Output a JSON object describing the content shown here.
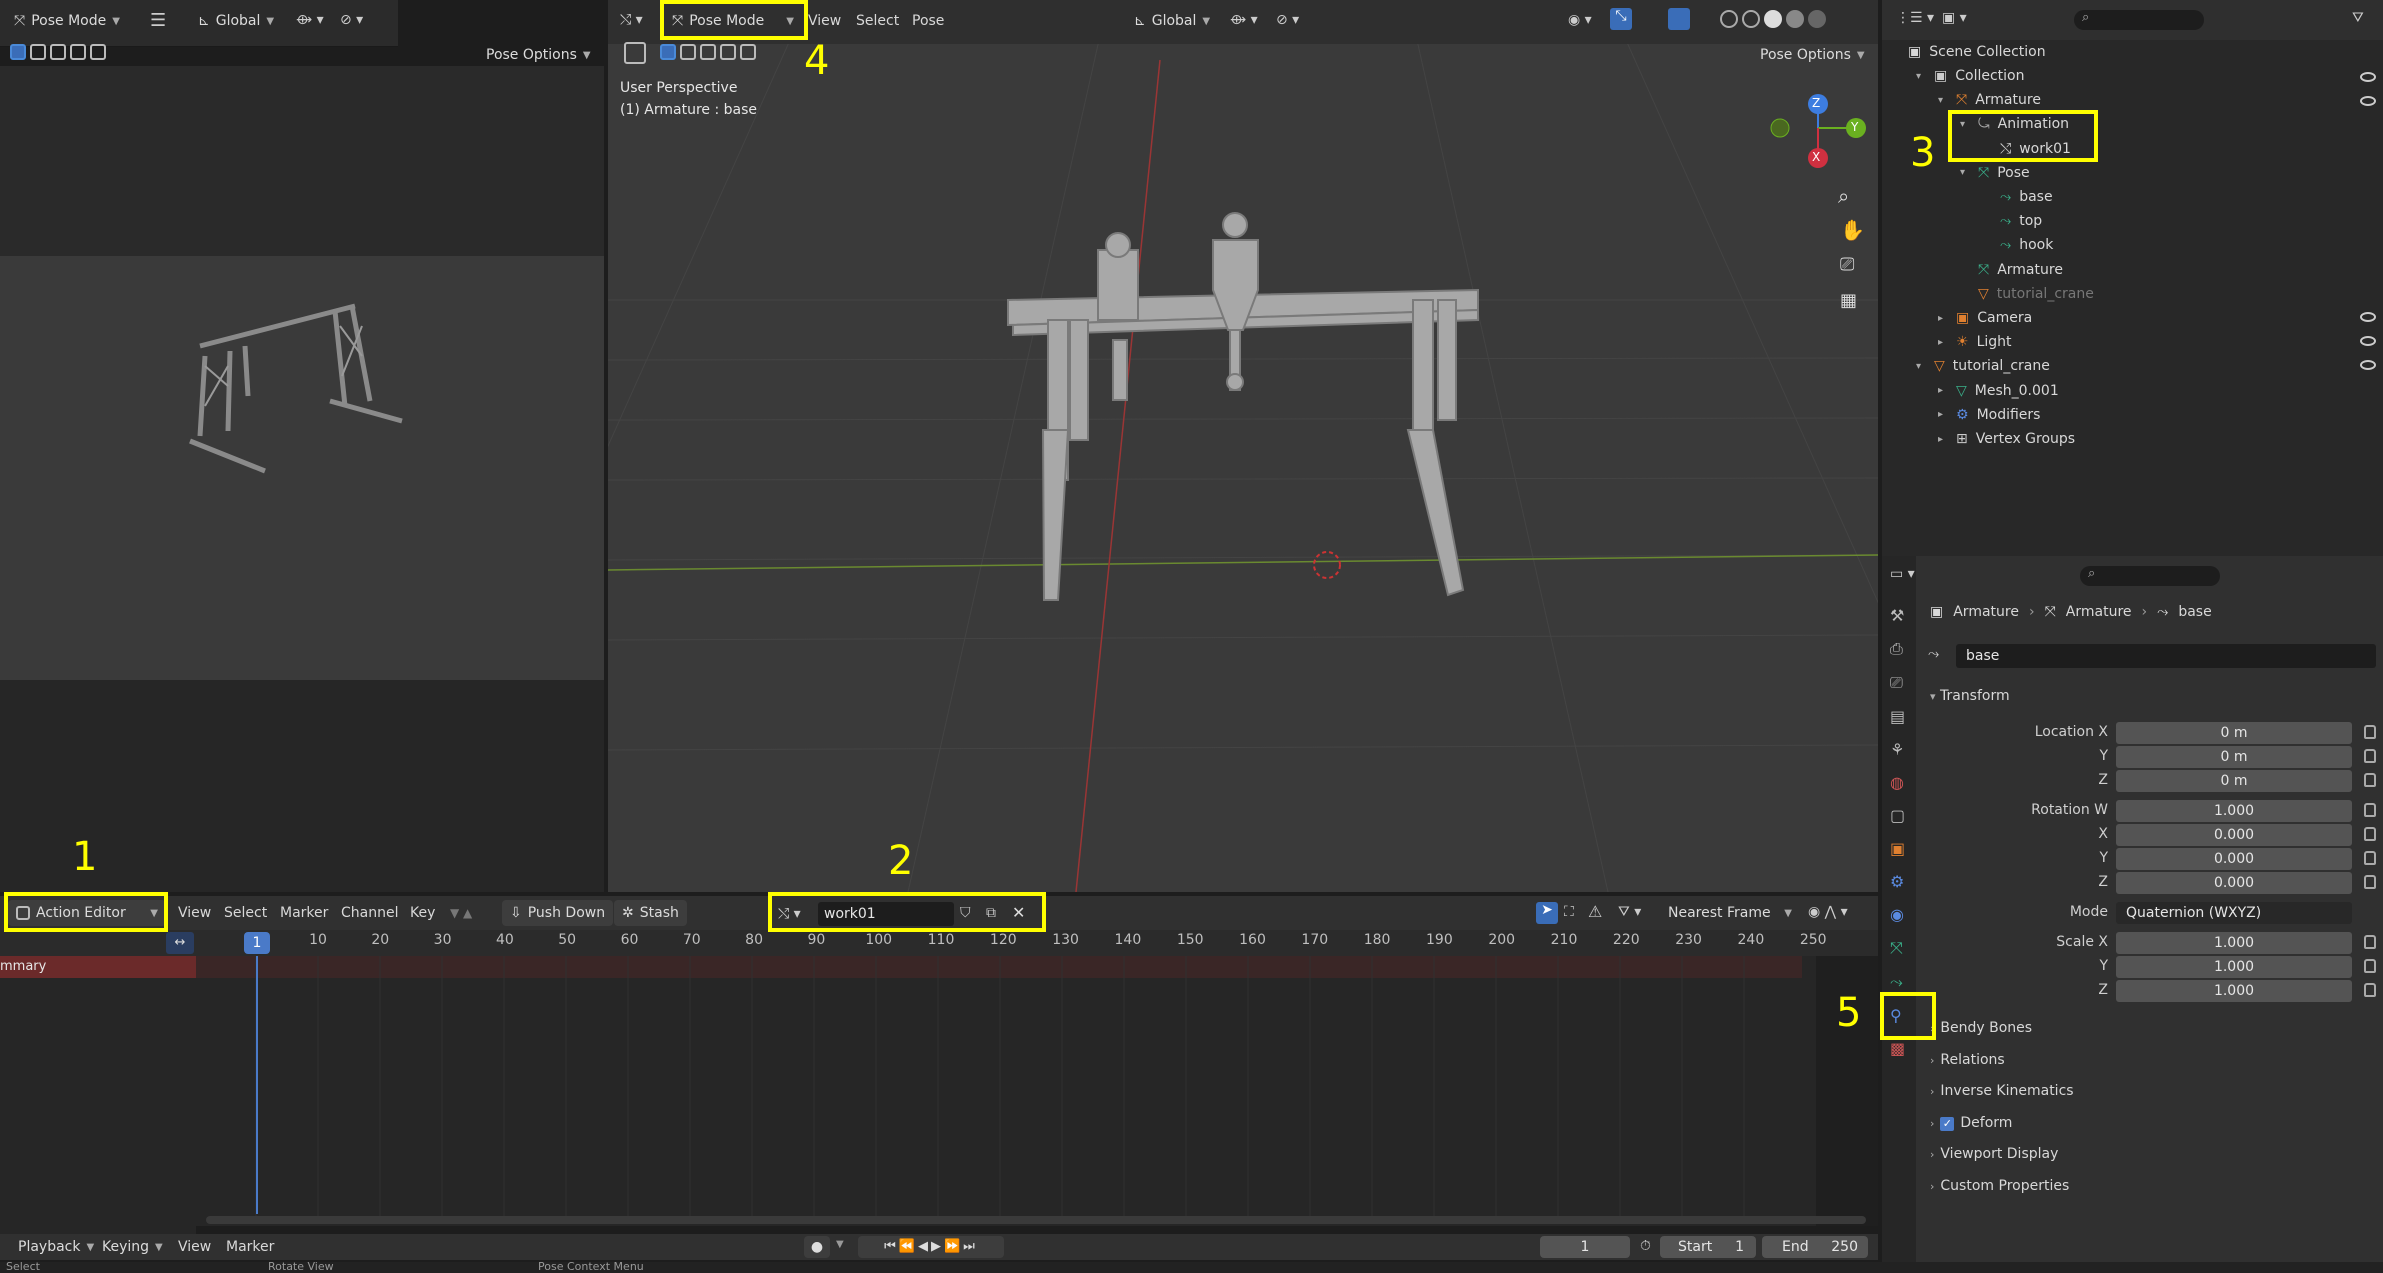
{
  "left_view": {
    "mode_label": "Pose Mode",
    "transform_label": "Global",
    "pose_options": "Pose Options"
  },
  "viewport": {
    "mode_label": "Pose Mode",
    "menus": [
      "View",
      "Select",
      "Pose"
    ],
    "transform_label": "Global",
    "pose_options": "Pose Options",
    "perspective": "User Perspective",
    "object_info": "(1) Armature : base",
    "gizmo_axes": [
      "Z",
      "Y",
      "X"
    ]
  },
  "outliner": {
    "root": "Scene Collection",
    "items": [
      {
        "label": "Collection",
        "level": 0,
        "expand": "▾"
      },
      {
        "label": "Armature",
        "level": 1,
        "expand": "▾"
      },
      {
        "label": "Animation",
        "level": 2,
        "expand": "▾"
      },
      {
        "label": "work01",
        "level": 3,
        "expand": ""
      },
      {
        "label": "Pose",
        "level": 2,
        "expand": "▾"
      },
      {
        "label": "base",
        "level": 3,
        "expand": ""
      },
      {
        "label": "top",
        "level": 3,
        "expand": ""
      },
      {
        "label": "hook",
        "level": 3,
        "expand": ""
      },
      {
        "label": "Armature",
        "level": 2,
        "expand": ""
      },
      {
        "label": "tutorial_crane",
        "level": 2,
        "expand": ""
      },
      {
        "label": "Camera",
        "level": 1,
        "expand": "▸"
      },
      {
        "label": "Light",
        "level": 1,
        "expand": "▸"
      },
      {
        "label": "tutorial_crane",
        "level": 0,
        "expand": "▾"
      },
      {
        "label": "Mesh_0.001",
        "level": 1,
        "expand": "▸"
      },
      {
        "label": "Modifiers",
        "level": 1,
        "expand": "▸"
      },
      {
        "label": "Vertex Groups",
        "level": 1,
        "expand": "▸"
      }
    ]
  },
  "properties": {
    "breadcrumb": [
      "Armature",
      "Armature",
      "base"
    ],
    "bone_name": "base",
    "transform_title": "Transform",
    "location_label": "Location X",
    "location": [
      "0 m",
      "0 m",
      "0 m"
    ],
    "rotation_label": "Rotation W",
    "rotation": [
      "1.000",
      "0.000",
      "0.000",
      "0.000"
    ],
    "axis_labels": [
      "X",
      "Y",
      "Z"
    ],
    "mode_label": "Mode",
    "mode_value": "Quaternion (WXYZ)",
    "scale_label": "Scale X",
    "scale": [
      "1.000",
      "1.000",
      "1.000"
    ],
    "panels": [
      "Bendy Bones",
      "Relations",
      "Inverse Kinematics",
      "Deform",
      "Viewport Display",
      "Custom Properties"
    ]
  },
  "action_editor": {
    "editor_type": "Action Editor",
    "menus": [
      "View",
      "Select",
      "Marker",
      "Channel",
      "Key"
    ],
    "push_down": "Push Down",
    "stash": "Stash",
    "action_name": "work01",
    "snap_mode": "Nearest Frame",
    "summary_label": "mmary",
    "current_frame_badge": "1",
    "frame_ticks": [
      "10",
      "20",
      "30",
      "40",
      "50",
      "60",
      "70",
      "80",
      "90",
      "100",
      "110",
      "120",
      "130",
      "140",
      "150",
      "160",
      "170",
      "180",
      "190",
      "200",
      "210",
      "220",
      "230",
      "240",
      "250"
    ]
  },
  "timeline": {
    "menus": [
      "Playback",
      "Keying",
      "View",
      "Marker"
    ],
    "current_frame": "1",
    "start_label": "Start",
    "start_value": "1",
    "end_label": "End",
    "end_value": "250"
  },
  "status_bar": {
    "left": "Select",
    "middle": "Rotate View",
    "right": "Pose Context Menu"
  },
  "annotations": [
    "1",
    "2",
    "3",
    "4",
    "5"
  ]
}
